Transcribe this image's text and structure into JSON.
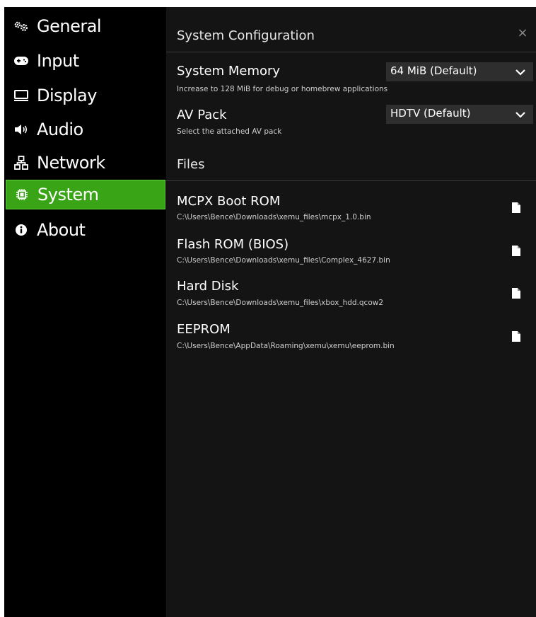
{
  "sidebar": {
    "items": [
      {
        "label": "General",
        "icon": "gears-icon",
        "active": false
      },
      {
        "label": "Input",
        "icon": "gamepad-icon",
        "active": false
      },
      {
        "label": "Display",
        "icon": "monitor-icon",
        "active": false
      },
      {
        "label": "Audio",
        "icon": "speaker-icon",
        "active": false
      },
      {
        "label": "Network",
        "icon": "network-icon",
        "active": false
      },
      {
        "label": "System",
        "icon": "chip-icon",
        "active": true
      },
      {
        "label": "About",
        "icon": "info-icon",
        "active": false
      }
    ],
    "active_color": "#3aa417"
  },
  "main": {
    "config_title": "System Configuration",
    "close_icon": "×",
    "system_memory": {
      "label": "System Memory",
      "description": "Increase to 128 MiB for debug or homebrew applications",
      "value": "64 MiB (Default)"
    },
    "av_pack": {
      "label": "AV Pack",
      "description": "Select the attached AV pack",
      "value": "HDTV (Default)"
    },
    "files_title": "Files",
    "files": [
      {
        "label": "MCPX Boot ROM",
        "path": "C:\\Users\\Bence\\Downloads\\xemu_files\\mcpx_1.0.bin"
      },
      {
        "label": "Flash ROM (BIOS)",
        "path": "C:\\Users\\Bence\\Downloads\\xemu_files\\Complex_4627.bin"
      },
      {
        "label": "Hard Disk",
        "path": "C:\\Users\\Bence\\Downloads\\xemu_files\\xbox_hdd.qcow2"
      },
      {
        "label": "EEPROM",
        "path": "C:\\Users\\Bence\\AppData\\Roaming\\xemu\\xemu\\eeprom.bin"
      }
    ]
  }
}
